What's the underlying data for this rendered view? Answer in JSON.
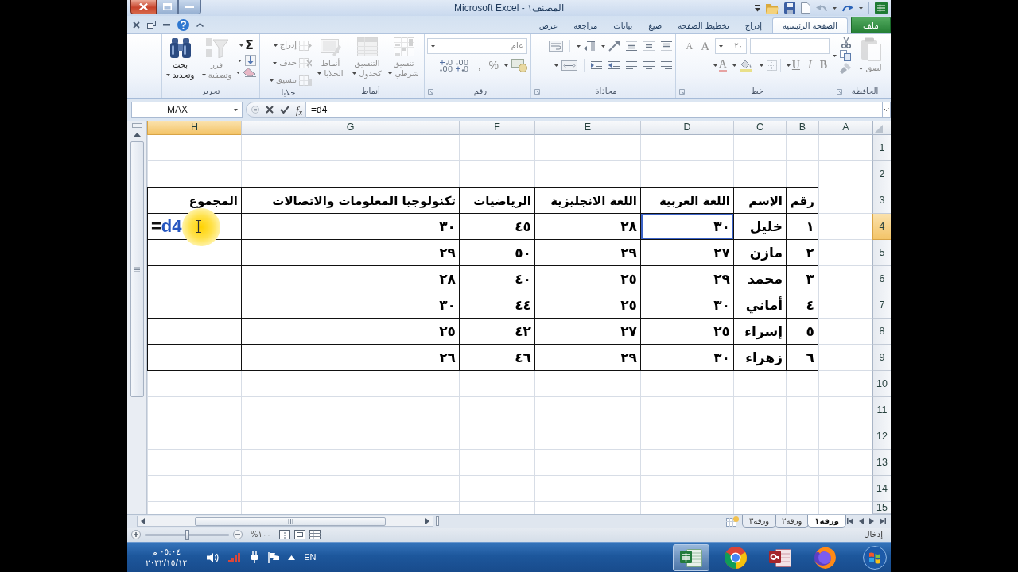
{
  "window": {
    "title": "Microsoft Excel - المصنف١"
  },
  "tabs": [
    {
      "label": "ملف",
      "kind": "file",
      "selected": false
    },
    {
      "label": "الصفحة الرئيسية",
      "kind": "tab",
      "selected": true
    },
    {
      "label": "إدراج",
      "kind": "tab",
      "selected": false
    },
    {
      "label": "تخطيط الصفحة",
      "kind": "tab",
      "selected": false
    },
    {
      "label": "صيغ",
      "kind": "tab",
      "selected": false
    },
    {
      "label": "بيانات",
      "kind": "tab",
      "selected": false
    },
    {
      "label": "مراجعة",
      "kind": "tab",
      "selected": false
    },
    {
      "label": "عرض",
      "kind": "tab",
      "selected": false
    }
  ],
  "ribbon": [
    {
      "label": "الحافظة",
      "kind": "clipboard",
      "buttons": [
        {
          "label": "لصق",
          "kind": "paste",
          "disabled": true
        }
      ]
    },
    {
      "label": "خط",
      "kind": "font",
      "font_size": "٢٠",
      "buttons": [
        {
          "label": "A",
          "kind": "grow",
          "disabled": true
        },
        {
          "label": "A",
          "kind": "shrink",
          "disabled": true
        },
        {
          "label": "B",
          "kind": "bold",
          "disabled": true
        },
        {
          "label": "I",
          "kind": "italic",
          "disabled": true
        },
        {
          "label": "U",
          "kind": "underline",
          "disabled": true
        },
        {
          "label": "A",
          "kind": "font_color",
          "disabled": true
        }
      ]
    },
    {
      "label": "محاذاة",
      "kind": "alignment"
    },
    {
      "label": "رقم",
      "kind": "number",
      "number_format": "عام",
      "buttons": [
        {
          "label": "%",
          "kind": "percent",
          "disabled": true
        },
        {
          "label": ",",
          "kind": "comma",
          "disabled": true
        }
      ]
    },
    {
      "label": "أنماط",
      "kind": "styles",
      "buttons": [
        {
          "label": "تنسيق شرطي",
          "kind": "conditional",
          "disabled": true
        },
        {
          "label": "التنسيق كجدول",
          "kind": "as_table",
          "disabled": true
        },
        {
          "label": "أنماط الخلايا",
          "kind": "cell_styles",
          "disabled": true
        }
      ]
    },
    {
      "label": "خلايا",
      "kind": "cells",
      "buttons": [
        {
          "label": "إدراج",
          "kind": "insert",
          "disabled": true
        },
        {
          "label": "حذف",
          "kind": "delete",
          "disabled": true
        },
        {
          "label": "تنسيق",
          "kind": "format",
          "disabled": true
        }
      ]
    },
    {
      "label": "تحرير",
      "kind": "editing",
      "buttons": [
        {
          "label": "Σ",
          "kind": "autosum",
          "disabled": false
        },
        {
          "label": "فرز وتصفية",
          "kind": "sort",
          "disabled": true
        },
        {
          "label": "بحث وتحديد",
          "kind": "find",
          "disabled": false
        }
      ]
    }
  ],
  "formula_bar": {
    "name_box": "MAX",
    "function_label": "f$_{x}$",
    "formula": "=d4"
  },
  "sheet": {
    "columns": [
      {
        "label": "A",
        "selected": false
      },
      {
        "label": "B",
        "selected": false
      },
      {
        "label": "C",
        "selected": false
      },
      {
        "label": "D",
        "selected": false
      },
      {
        "label": "E",
        "selected": false
      },
      {
        "label": "F",
        "selected": false
      },
      {
        "label": "G",
        "selected": false
      },
      {
        "label": "H",
        "selected": true
      }
    ],
    "rows": [
      {
        "label": "1",
        "selected": false
      },
      {
        "label": "2",
        "selected": false
      },
      {
        "label": "3",
        "selected": false
      },
      {
        "label": "4",
        "selected": true
      },
      {
        "label": "5",
        "selected": false
      },
      {
        "label": "6",
        "selected": false
      },
      {
        "label": "7",
        "selected": false
      },
      {
        "label": "8",
        "selected": false
      },
      {
        "label": "9",
        "selected": false
      },
      {
        "label": "10",
        "selected": false
      },
      {
        "label": "11",
        "selected": false
      },
      {
        "label": "12",
        "selected": false
      },
      {
        "label": "13",
        "selected": false
      },
      {
        "label": "14",
        "selected": false
      },
      {
        "label": "15",
        "selected": false
      }
    ],
    "table": {
      "header": [
        "رقم",
        "الإسم",
        "اللغة العربية",
        "اللغة الانجليزية",
        "الرياضيات",
        "تكنولوجيا المعلومات والاتصالات",
        "المجموع"
      ],
      "rows": [
        [
          {
            "text": "١",
            "referenced": false
          },
          {
            "text": "خليل",
            "referenced": false
          },
          {
            "text": "٣٠",
            "referenced": true
          },
          {
            "text": "٢٨",
            "referenced": false
          },
          {
            "text": "٤٥",
            "referenced": false
          },
          {
            "text": "٣٠",
            "referenced": false
          }
        ],
        [
          {
            "text": "٢",
            "referenced": false
          },
          {
            "text": "مازن",
            "referenced": false
          },
          {
            "text": "٢٧",
            "referenced": false
          },
          {
            "text": "٢٩",
            "referenced": false
          },
          {
            "text": "٥٠",
            "referenced": false
          },
          {
            "text": "٢٩",
            "referenced": false
          }
        ],
        [
          {
            "text": "٣",
            "referenced": false
          },
          {
            "text": "محمد",
            "referenced": false
          },
          {
            "text": "٢٩",
            "referenced": false
          },
          {
            "text": "٢٥",
            "referenced": false
          },
          {
            "text": "٤٠",
            "referenced": false
          },
          {
            "text": "٢٨",
            "referenced": false
          }
        ],
        [
          {
            "text": "٤",
            "referenced": false
          },
          {
            "text": "أماني",
            "referenced": false
          },
          {
            "text": "٣٠",
            "referenced": false
          },
          {
            "text": "٢٥",
            "referenced": false
          },
          {
            "text": "٤٤",
            "referenced": false
          },
          {
            "text": "٣٠",
            "referenced": false
          }
        ],
        [
          {
            "text": "٥",
            "referenced": false
          },
          {
            "text": "إسراء",
            "referenced": false
          },
          {
            "text": "٢٥",
            "referenced": false
          },
          {
            "text": "٢٧",
            "referenced": false
          },
          {
            "text": "٤٢",
            "referenced": false
          },
          {
            "text": "٢٥",
            "referenced": false
          }
        ],
        [
          {
            "text": "٦",
            "referenced": false
          },
          {
            "text": "زهراء",
            "referenced": false
          },
          {
            "text": "٣٠",
            "referenced": false
          },
          {
            "text": "٢٩",
            "referenced": false
          },
          {
            "text": "٤٦",
            "referenced": false
          },
          {
            "text": "٢٦",
            "referenced": false
          }
        ]
      ]
    },
    "active_cell": {
      "operator": "=",
      "reference": "d4"
    }
  },
  "sheet_tabs": [
    {
      "label": "ورقة١",
      "selected": true
    },
    {
      "label": "ورقة٢",
      "selected": false
    },
    {
      "label": "ورقة٣",
      "selected": false
    }
  ],
  "status_bar": {
    "mode": "إدخال",
    "zoom": {
      "label": "١٠٠%",
      "level": 0.5
    }
  },
  "taskbar": {
    "apps": [
      {
        "kind": "firefox",
        "active": false
      },
      {
        "kind": "access",
        "active": false
      },
      {
        "kind": "chrome",
        "active": false
      },
      {
        "kind": "excel",
        "active": true
      }
    ],
    "language": "EN",
    "time": "٠٥:٠٤ م",
    "date": "٢٠٢٢/١٥/١٢"
  }
}
